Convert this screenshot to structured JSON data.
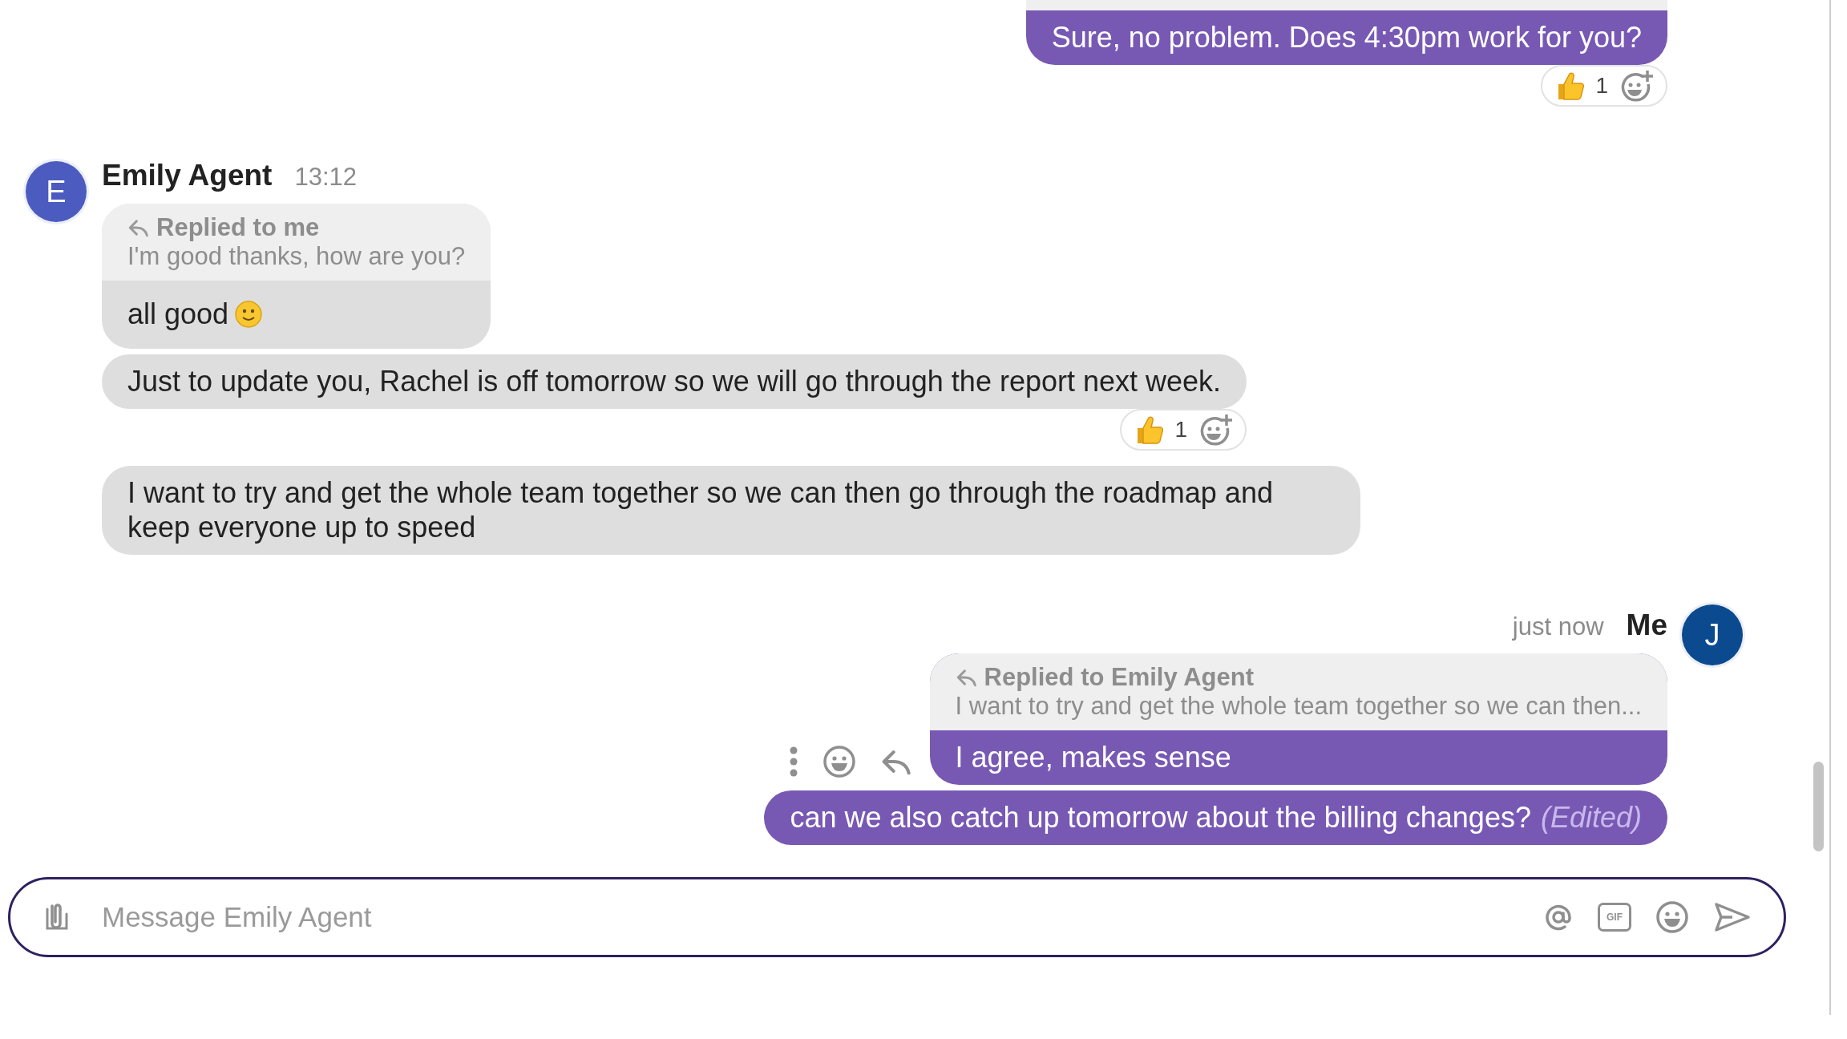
{
  "groups": [
    {
      "kind": "outgoing",
      "has_reply_above": true,
      "messages": [
        {
          "text": "Sure, no problem. Does 4:30pm work for you?",
          "reactions": [
            {
              "kind": "thumbs-up",
              "count": "1"
            }
          ]
        }
      ]
    },
    {
      "kind": "incoming",
      "sender": "Emily Agent",
      "time": "13:12",
      "avatar_letter": "E",
      "color": "#4b5bc0",
      "messages": [
        {
          "kind": "with-smile",
          "reply": {
            "label": "Replied to me",
            "quote": "I'm good thanks, how are you?"
          },
          "text": "all good"
        },
        {
          "text": "Just to update you, Rachel is off tomorrow so we will go through the report next week.",
          "reactions": [
            {
              "kind": "thumbs-up",
              "count": "1"
            }
          ]
        },
        {
          "text": "I want to try and get the whole team together so we can then go through the roadmap and keep everyone up to speed"
        }
      ]
    },
    {
      "kind": "outgoing",
      "sender": "Me",
      "time": "just now",
      "avatar_letter": "J",
      "color": "#0c4a90",
      "messages": [
        {
          "reply": {
            "label": "Replied to Emily Agent",
            "quote": "I want to try and get the whole team together so we can then..."
          },
          "text": "I agree, makes sense",
          "hovered": true
        },
        {
          "text": "can we also catch up tomorrow about the billing changes?",
          "edited_label": "(Edited)"
        }
      ]
    }
  ],
  "composer": {
    "placeholder": "Message Emily Agent",
    "gif_label": "GIF"
  }
}
